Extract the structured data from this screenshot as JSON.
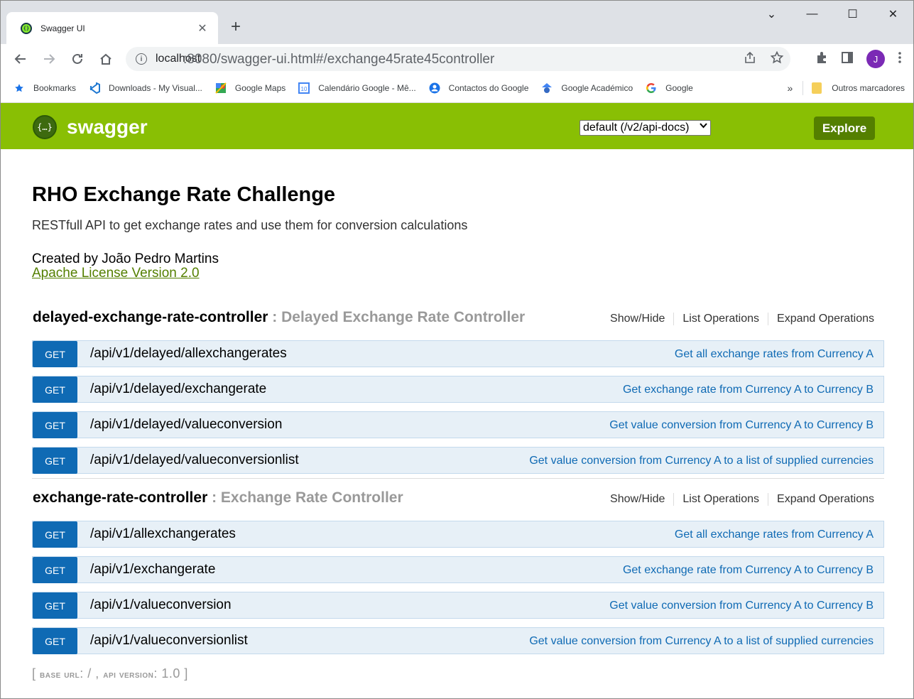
{
  "browser": {
    "tab_title": "Swagger UI",
    "tab_close": "✕",
    "new_tab": "+",
    "window_controls": [
      "⌄",
      "—",
      "☐",
      "✕"
    ],
    "url_host": "localhost",
    "url_path": ":8080/swagger-ui.html#/exchange45rate45controller",
    "avatar_letter": "J",
    "bookmarks": [
      {
        "label": "Bookmarks",
        "icon": "star-icon"
      },
      {
        "label": "Downloads - My Visual...",
        "icon": "visual-studio-icon"
      },
      {
        "label": "Google Maps",
        "icon": "google-maps-icon"
      },
      {
        "label": "Calendário Google - Mê...",
        "icon": "google-calendar-icon"
      },
      {
        "label": "Contactos do Google",
        "icon": "google-contacts-icon"
      },
      {
        "label": "Google Académico",
        "icon": "google-scholar-icon"
      },
      {
        "label": "Google",
        "icon": "google-icon"
      }
    ],
    "bookmarks_more": "»",
    "other_bookmarks": "Outros marcadores"
  },
  "header": {
    "logo_text": "swagger",
    "logo_mark": "{…}",
    "spec_select": "default (/v2/api-docs)",
    "explore_label": "Explore",
    "brand_color": "#89bf04"
  },
  "info": {
    "title": "RHO Exchange Rate Challenge",
    "description": "RESTfull API to get exchange rates and use them for conversion calculations",
    "contact": "Created by João Pedro Martins",
    "license": "Apache License Version 2.0"
  },
  "resources": [
    {
      "name": "delayed-exchange-rate-controller",
      "description": " : Delayed Exchange Rate Controller",
      "links": [
        "Show/Hide",
        "List Operations",
        "Expand Operations"
      ],
      "operations": [
        {
          "method": "GET",
          "path": "/api/v1/delayed/allexchangerates",
          "summary": "Get all exchange rates from Currency A"
        },
        {
          "method": "GET",
          "path": "/api/v1/delayed/exchangerate",
          "summary": "Get exchange rate from Currency A to Currency B"
        },
        {
          "method": "GET",
          "path": "/api/v1/delayed/valueconversion",
          "summary": "Get value conversion from Currency A to Currency B"
        },
        {
          "method": "GET",
          "path": "/api/v1/delayed/valueconversionlist",
          "summary": "Get value conversion from Currency A to a list of supplied currencies"
        }
      ]
    },
    {
      "name": "exchange-rate-controller",
      "description": " : Exchange Rate Controller",
      "links": [
        "Show/Hide",
        "List Operations",
        "Expand Operations"
      ],
      "operations": [
        {
          "method": "GET",
          "path": "/api/v1/allexchangerates",
          "summary": "Get all exchange rates from Currency A"
        },
        {
          "method": "GET",
          "path": "/api/v1/exchangerate",
          "summary": "Get exchange rate from Currency A to Currency B"
        },
        {
          "method": "GET",
          "path": "/api/v1/valueconversion",
          "summary": "Get value conversion from Currency A to Currency B"
        },
        {
          "method": "GET",
          "path": "/api/v1/valueconversionlist",
          "summary": "Get value conversion from Currency A to a list of supplied currencies"
        }
      ]
    }
  ],
  "footer": {
    "open": "[ ",
    "base_url_label": "base url",
    "base_url_value": ": / , ",
    "api_version_label": "api version",
    "api_version_value": ": 1.0",
    "close": " ]"
  }
}
